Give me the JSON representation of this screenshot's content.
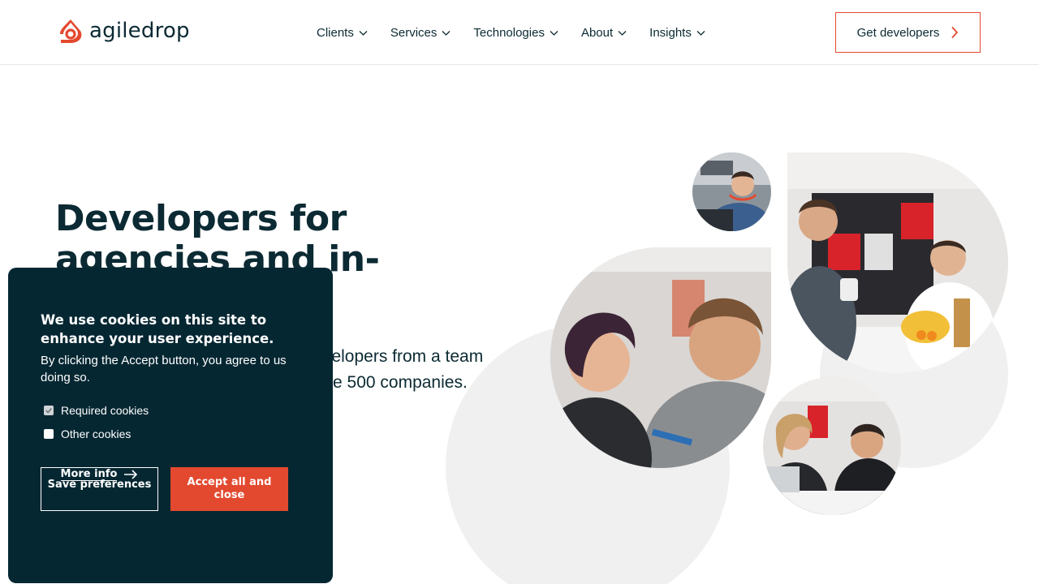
{
  "brand": {
    "name": "agiledrop",
    "accent": "#e3492f",
    "dark": "#052732"
  },
  "nav": {
    "items": [
      {
        "label": "Clients"
      },
      {
        "label": "Services"
      },
      {
        "label": "Technologies"
      },
      {
        "label": "About"
      },
      {
        "label": "Insights"
      }
    ],
    "cta_label": "Get developers"
  },
  "hero": {
    "title": "Developers for agencies and in-house teams",
    "text": "Get Drupal, JavaScript and PHP developers from a team that builds digital solutions for Fortune 500 companies."
  },
  "cookie": {
    "title": "We use cookies on this site to enhance your user experience.",
    "description": "By clicking the Accept button, you agree to us doing so.",
    "required_label": "Required cookies",
    "other_label": "Other cookies",
    "required_checked": true,
    "other_checked": false,
    "more_info_label": "More info",
    "save_label": "Save preferences",
    "accept_label": "Accept all and close"
  }
}
